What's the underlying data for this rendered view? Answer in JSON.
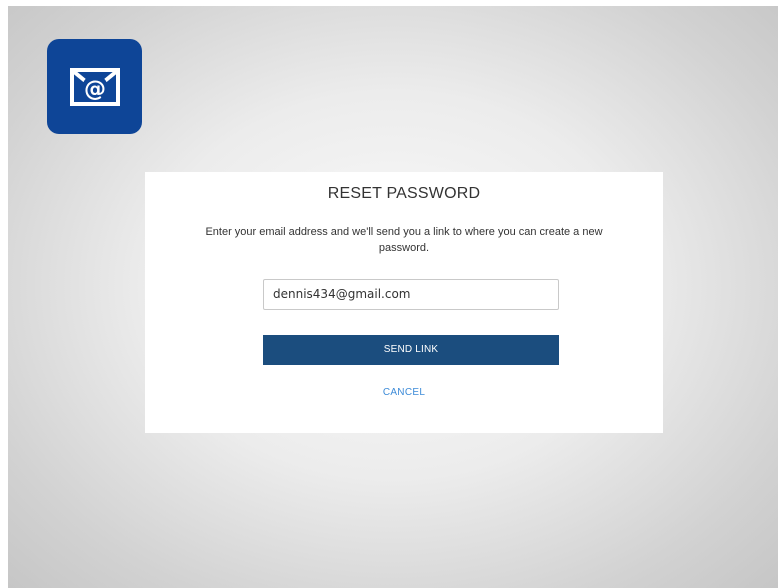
{
  "app_icon": {
    "icon": "email-at-icon",
    "background_color": "#0e4597"
  },
  "dialog": {
    "title": "RESET PASSWORD",
    "description": "Enter your email address and we'll send you a link to where you can create a new password.",
    "email_value": "dennis434@gmail.com",
    "send_label": "SEND LINK",
    "cancel_label": "CANCEL",
    "button_color": "#1b4d7e",
    "link_color": "#3d8bd8"
  }
}
